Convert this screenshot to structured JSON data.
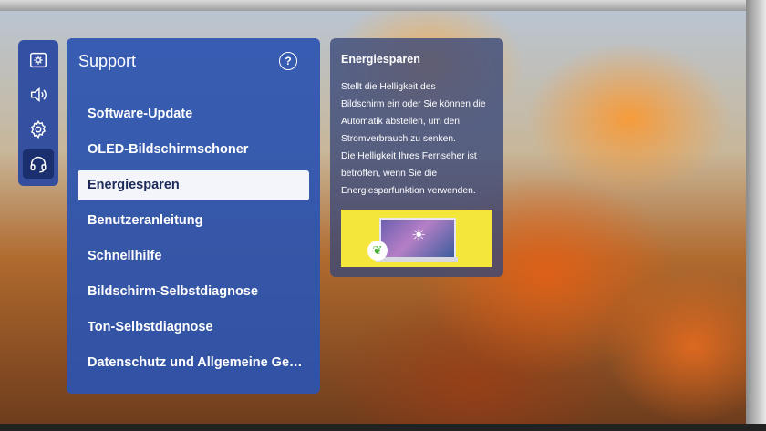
{
  "menu": {
    "title": "Support",
    "items": [
      {
        "label": "Software-Update",
        "selected": false
      },
      {
        "label": "OLED-Bildschirmschoner",
        "selected": false
      },
      {
        "label": "Energiesparen",
        "selected": true
      },
      {
        "label": "Benutzeranleitung",
        "selected": false
      },
      {
        "label": "Schnellhilfe",
        "selected": false
      },
      {
        "label": "Bildschirm-Selbstdiagnose",
        "selected": false
      },
      {
        "label": "Ton-Selbstdiagnose",
        "selected": false
      },
      {
        "label": "Datenschutz und Allgemeine Ges…",
        "selected": false
      }
    ]
  },
  "sidebar": {
    "icons": [
      "picture-settings-icon",
      "sound-icon",
      "gear-icon",
      "headset-support-icon"
    ],
    "active": "headset-support-icon"
  },
  "info": {
    "title": "Energiesparen",
    "text_lines": [
      "Stellt die Helligkeit des",
      "Bildschirm ein oder Sie können die",
      "Automatik abstellen, um den",
      "Stromverbrauch zu senken.",
      "Die Helligkeit Ihres Fernseher ist",
      "betroffen, wenn Sie die",
      "Energiesparfunktion verwenden."
    ]
  },
  "colors": {
    "menu_bg": "#2c54af",
    "selected_bg": "#f4f5fb",
    "illustration_bg": "#f4e63a"
  }
}
